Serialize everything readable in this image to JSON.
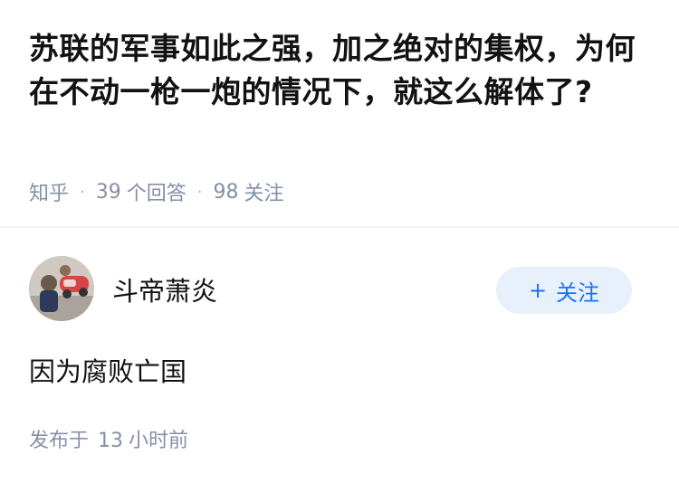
{
  "question": {
    "title": "苏联的军事如此之强，加之绝对的集权，为何在不动一枪一炮的情况下，就这么解体了?",
    "source": "知乎",
    "answer_count": "39",
    "answer_label": "个回答",
    "follower_count": "98",
    "follower_label": "关注"
  },
  "answer": {
    "author_name": "斗帝萧炎",
    "follow_button": {
      "icon": "plus-icon",
      "plus": "+",
      "label": "关注"
    },
    "text": "因为腐败亡国",
    "posted_label": "发布于",
    "posted_num": "13",
    "posted_unit": "小时前"
  },
  "colors": {
    "meta_text": "#8590a6",
    "follow_bg": "#e8f1fb",
    "follow_text": "#1772f6"
  }
}
